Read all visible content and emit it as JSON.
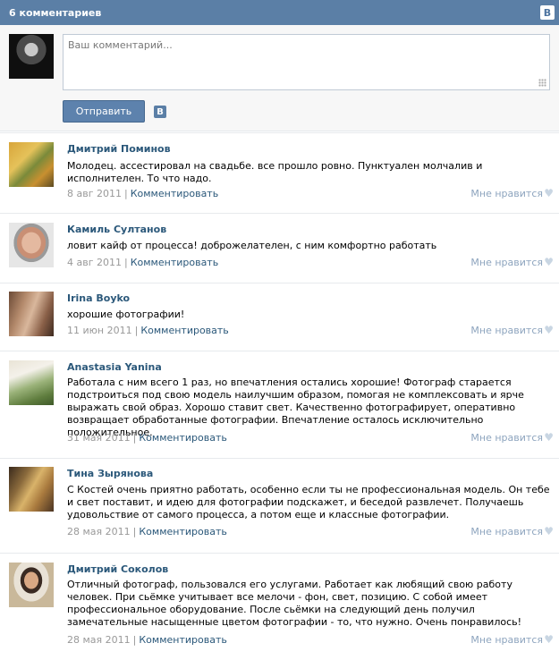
{
  "header": {
    "title": "6 комментариев",
    "vk_label": "B"
  },
  "form": {
    "placeholder": "Ваш комментарий...",
    "send_label": "Отправить",
    "vk_label": "B"
  },
  "comments": [
    {
      "author": "Дмитрий Поминов",
      "text": "Молодец. ассестировал на свадьбе. все прошло ровно. Пунктуален молчалив и исполнителен. То что надо.",
      "date": "8 авг 2011",
      "reply": "Комментировать",
      "like": "Мне нравится"
    },
    {
      "author": "Камиль Султанов",
      "text": "ловит кайф от процесса! доброжелателен, с ним комфортно работать",
      "date": "4 авг 2011",
      "reply": "Комментировать",
      "like": "Мне нравится"
    },
    {
      "author": "Irina Boyko",
      "text": "хорошие фотографии!",
      "date": "11 июн 2011",
      "reply": "Комментировать",
      "like": "Мне нравится"
    },
    {
      "author": "Anastasia Yanina",
      "text": "Работала с ним всего 1 раз, но впечатления остались хорошие! Фотограф старается подстроиться под свою модель наилучшим образом, помогая не комплексовать и ярче выражать свой образ. Хорошо ставит свет. Качественно фотографирует, оперативно возвращает обработанные фотографии. Впечатление осталось исключительно положительное.",
      "date": "31 мая 2011",
      "reply": "Комментировать",
      "like": "Мне нравится"
    },
    {
      "author": "Тина Зырянова",
      "text": "С Костей очень приятно работать, особенно если ты не профессиональная модель. Он тебе и свет поставит, и идею для фотографии подскажет, и беседой развлечет. Получаешь удовольствие от самого процесса, а потом еще и классные фотографии.",
      "date": "28 мая 2011",
      "reply": "Комментировать",
      "like": "Мне нравится"
    },
    {
      "author": "Дмитрий Соколов",
      "text": "Отличный фотограф, пользовался его услугами. Работает как любящий свою работу человек. При сьёмке учитывает все мелочи - фон, свет, позицию. С собой имеет профессиональное оборудование. После сьёмки на следующий день получил замечательные насыщенные цветом фотографии - то, что нужно. Очень понравилось!",
      "date": "28 мая 2011",
      "reply": "Комментировать",
      "like": "Мне нравится"
    }
  ]
}
